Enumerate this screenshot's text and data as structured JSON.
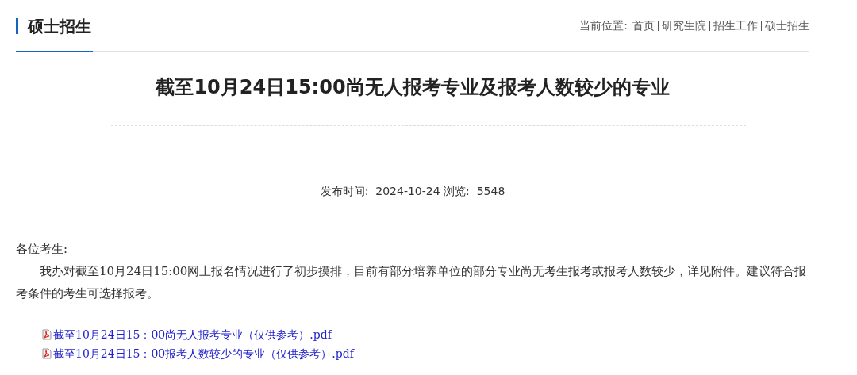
{
  "header": {
    "title": "硕士招生",
    "breadcrumb_label": "当前位置:",
    "breadcrumb": [
      "首页",
      "研究生院",
      "招生工作",
      "硕士招生"
    ]
  },
  "article": {
    "title": "截至10月24日15:00尚无人报考专业及报考人数较少的专业",
    "meta": "发布时间:  2024-10-24 浏览:  5548",
    "greeting": "各位考生:",
    "paragraph": "我办对截至10月24日15:00网上报名情况进行了初步摸排，目前有部分培养单位的部分专业尚无考生报考或报考人数较少，详见附件。建议符合报考条件的考生可选择报考。",
    "attachments": [
      "截至10月24日15：00尚无人报考专业（仅供参考）.pdf",
      "截至10月24日15：00报考人数较少的专业（仅供参考）.pdf"
    ]
  }
}
